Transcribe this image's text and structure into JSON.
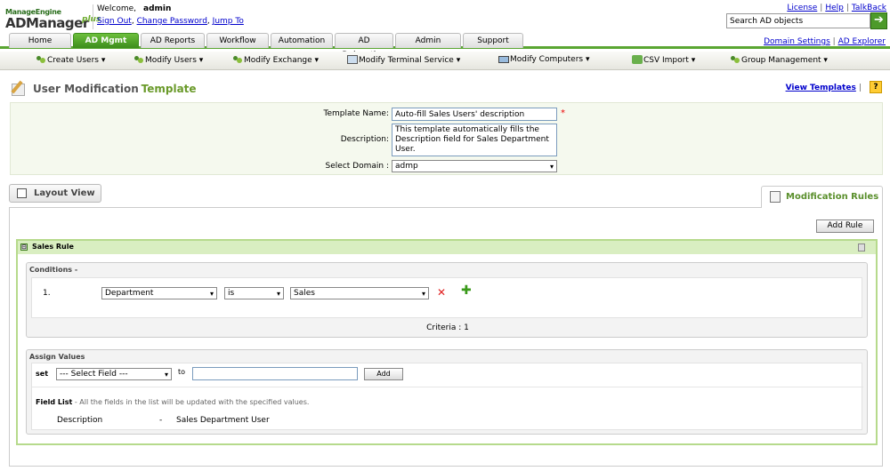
{
  "brand": {
    "company": "ManageEngine",
    "product": "ADManager",
    "plus": "plus"
  },
  "header": {
    "welcome": "Welcome,",
    "user": "admin",
    "links": {
      "signout": "Sign Out",
      "change_password": "Change Password",
      "jump_to": "Jump To",
      "sep1": ",",
      "sep2": ","
    },
    "top_links": {
      "license": "License",
      "help": "Help",
      "talkback": "TalkBack",
      "sep": "|"
    },
    "search": {
      "value": "Search AD objects",
      "button": "➔"
    }
  },
  "tabs": [
    {
      "label": "Home"
    },
    {
      "label": "AD Mgmt"
    },
    {
      "label": "AD Reports"
    },
    {
      "label": "Workflow"
    },
    {
      "label": "Automation"
    },
    {
      "label": "AD Delegation"
    },
    {
      "label": "Admin"
    },
    {
      "label": "Support"
    }
  ],
  "right_links": {
    "domain_settings": "Domain Settings",
    "ad_explorer": "AD Explorer",
    "sep": "|"
  },
  "menu": [
    {
      "label": "Create Users ▾",
      "icon": "users-icon"
    },
    {
      "label": "Modify Users ▾",
      "icon": "users-icon"
    },
    {
      "label": "Modify Exchange ▾",
      "icon": "users-icon"
    },
    {
      "label": "Modify Terminal Service ▾",
      "icon": "terminal-icon"
    },
    {
      "label": "Modify Computers ▾",
      "icon": "computer-icon"
    },
    {
      "label": "CSV Import ▾",
      "icon": "csv-icon"
    },
    {
      "label": "Group Management ▾",
      "icon": "users-icon"
    }
  ],
  "page": {
    "title_part1": "User Modification",
    "title_part2": "Template",
    "view_templates": "View Templates",
    "view_sep": "|",
    "help_icon": "?"
  },
  "form": {
    "template_name_label": "Template Name:",
    "template_name_value": "Auto-fill Sales Users' description",
    "required": "*",
    "description_label": "Description:",
    "description_value": "This template automatically fills the Description field for Sales Department User.",
    "domain_label": "Select Domain :",
    "domain_value": "admp"
  },
  "layout_view": "Layout View",
  "modification_rules": "Modification Rules",
  "add_rule": "Add Rule",
  "rule": {
    "toggle": "⊟",
    "name": "Sales Rule",
    "conditions_title": "Conditions -",
    "condition": {
      "index": "1.",
      "field": "Department",
      "operator": "is",
      "value": "Sales",
      "delete": "✕",
      "add": "✚"
    },
    "criteria": "Criteria : 1",
    "assign_title": "Assign Values",
    "set_label": "set",
    "select_field": "--- Select Field ---",
    "to_label": "to",
    "to_value": "",
    "add_button": "Add",
    "field_list_title": "Field List",
    "field_list_note": "- All the fields in the list will be updated with the specified values.",
    "fields": [
      {
        "name": "Description",
        "sep": "-",
        "value": "Sales Department User"
      }
    ]
  },
  "colors": {
    "accent": "#5aa632",
    "title_green": "#6a9a2a",
    "link": "#0000cc"
  }
}
